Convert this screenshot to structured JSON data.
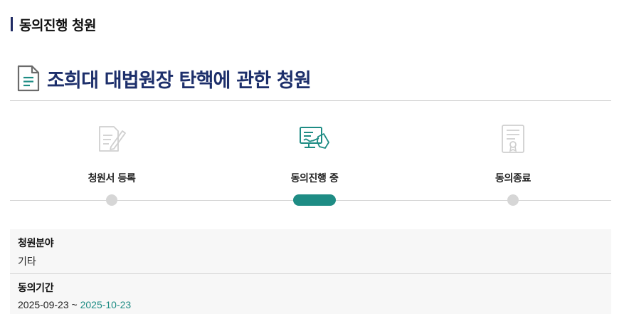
{
  "section": {
    "title": "동의진행 청원"
  },
  "petition": {
    "title": "조희대 대법원장 탄핵에 관한 청원"
  },
  "steps": [
    {
      "label": "청원서 등록",
      "icon": "document-pen-icon",
      "state": "done"
    },
    {
      "label": "동의진행 중",
      "icon": "computer-signing-icon",
      "state": "current"
    },
    {
      "label": "동의종료",
      "icon": "certificate-icon",
      "state": "pending"
    }
  ],
  "info": {
    "category": {
      "label": "청원분야",
      "value": "기타"
    },
    "period": {
      "label": "동의기간",
      "start": "2025-09-23",
      "separator": "~",
      "end": "2025-10-23"
    }
  },
  "colors": {
    "accent": "#1e8c84",
    "title": "#1d2f6b",
    "inactive": "#d6d6d6"
  }
}
